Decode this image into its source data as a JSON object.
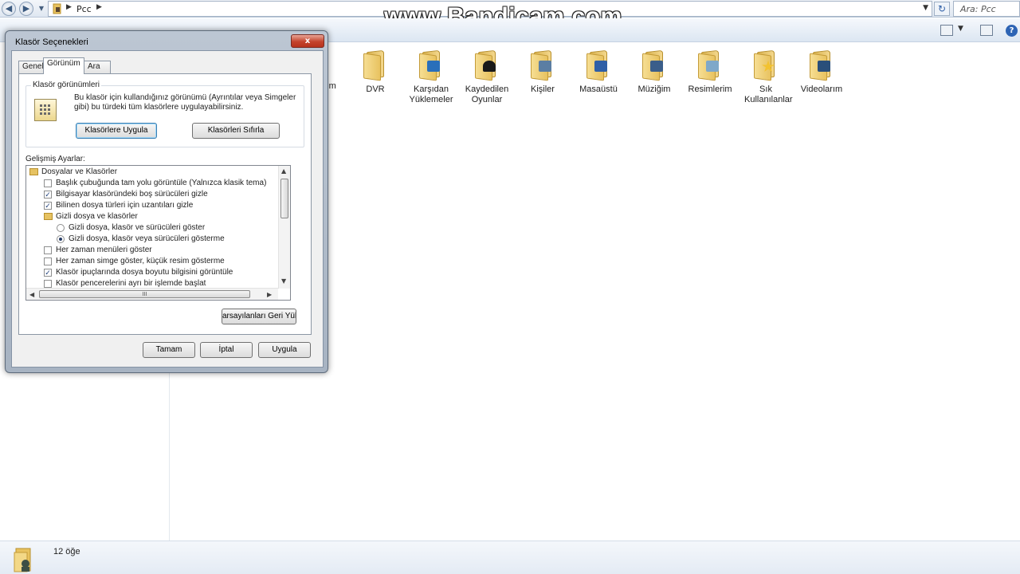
{
  "address_bar": {
    "breadcrumb": "Pcc",
    "search_placeholder": "Ara: Pcc"
  },
  "watermark": "www.Bandicam.com",
  "folders": [
    {
      "label": "DVR",
      "icon": "folder-icon",
      "emblem": "none",
      "left": 0
    },
    {
      "label": "Karşıdan Yüklemeler",
      "icon": "downloads-folder-icon",
      "emblem": "#2a6fba"
    },
    {
      "label": "Kaydedilen Oyunlar",
      "icon": "saved-games-folder-icon",
      "emblem": "#1a1a1a"
    },
    {
      "label": "Kişiler",
      "icon": "contacts-folder-icon",
      "emblem": "#5b7ea3"
    },
    {
      "label": "Masaüstü",
      "icon": "desktop-folder-icon",
      "emblem": "#2f5fa6"
    },
    {
      "label": "Müziğim",
      "icon": "music-folder-icon",
      "emblem": "#3b5e8a"
    },
    {
      "label": "Resimlerim",
      "icon": "pictures-folder-icon",
      "emblem": "#7fa8c9"
    },
    {
      "label": "Sık Kullanılanlar",
      "icon": "favorites-folder-icon",
      "emblem": "#f2c230"
    },
    {
      "label": "Videolarım",
      "icon": "videos-folder-icon",
      "emblem": "#2a4f7a"
    }
  ],
  "partial_item_label": "lerim",
  "status": {
    "count": "12 öğe"
  },
  "dialog": {
    "title": "Klasör Seçenekleri",
    "close": "x",
    "tabs": [
      "Genel",
      "Görünüm",
      "Ara"
    ],
    "group_title": "Klasör görünümleri",
    "group_text": "Bu klasör için kullandığınız görünümü (Ayrıntılar veya Simgeler gibi) bu türdeki tüm klasörlere uygulayabilirsiniz.",
    "apply_folders_button": "Klasörlere Uygula",
    "reset_folders_button": "Klasörleri Sıfırla",
    "advanced_label": "Gelişmiş Ayarlar:",
    "tree_rows": [
      {
        "kind": "folder",
        "indent": 0,
        "text": "Dosyalar ve Klasörler"
      },
      {
        "kind": "checkbox",
        "checked": false,
        "text": "Başlık çubuğunda tam yolu görüntüle (Yalnızca klasik tema)"
      },
      {
        "kind": "checkbox",
        "checked": true,
        "text": "Bilgisayar klasöründeki boş sürücüleri gizle"
      },
      {
        "kind": "checkbox",
        "checked": true,
        "text": "Bilinen dosya türleri için uzantıları gizle"
      },
      {
        "kind": "folder",
        "text": "Gizli dosya ve klasörler"
      },
      {
        "kind": "radio",
        "checked": false,
        "text": "Gizli dosya, klasör ve sürücüleri göster"
      },
      {
        "kind": "radio",
        "checked": true,
        "text": "Gizli dosya, klasör veya sürücüleri gösterme"
      },
      {
        "kind": "checkbox",
        "checked": false,
        "text": "Her zaman menüleri göster"
      },
      {
        "kind": "checkbox",
        "checked": false,
        "text": "Her zaman simge göster, küçük resim gösterme"
      },
      {
        "kind": "checkbox",
        "checked": true,
        "text": "Klasör ipuçlarında dosya boyutu bilgisini görüntüle"
      },
      {
        "kind": "checkbox",
        "checked": false,
        "text": "Klasör pencerelerini ayrı bir işlemde başlat"
      }
    ],
    "restore_defaults_button": "arsayılanları Geri Yük",
    "ok_button": "Tamam",
    "cancel_button": "İptal",
    "apply_button": "Uygula"
  }
}
